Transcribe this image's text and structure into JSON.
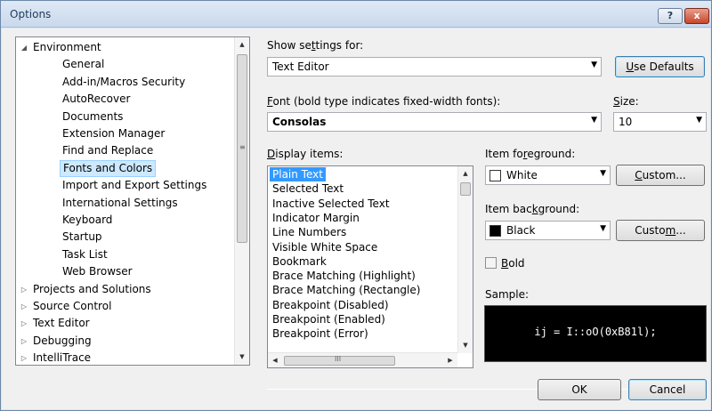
{
  "window": {
    "title": "Options",
    "help_label": "?",
    "close_label": "x"
  },
  "tree": {
    "items": [
      {
        "label": "Environment",
        "expander": "◢"
      },
      {
        "label": "General"
      },
      {
        "label": "Add-in/Macros Security"
      },
      {
        "label": "AutoRecover"
      },
      {
        "label": "Documents"
      },
      {
        "label": "Extension Manager"
      },
      {
        "label": "Find and Replace"
      },
      {
        "label": "Fonts and Colors",
        "selected": true
      },
      {
        "label": "Import and Export Settings"
      },
      {
        "label": "International Settings"
      },
      {
        "label": "Keyboard"
      },
      {
        "label": "Startup"
      },
      {
        "label": "Task List"
      },
      {
        "label": "Web Browser"
      },
      {
        "label": "Projects and Solutions",
        "expander": "▷"
      },
      {
        "label": "Source Control",
        "expander": "▷"
      },
      {
        "label": "Text Editor",
        "expander": "▷"
      },
      {
        "label": "Debugging",
        "expander": "▷"
      },
      {
        "label": "IntelliTrace",
        "expander": "▷"
      }
    ]
  },
  "show_settings": {
    "label_pre": "Show se",
    "label_key": "t",
    "label_post": "tings for:",
    "value": "Text Editor"
  },
  "use_defaults": {
    "label_key": "U",
    "label_post": "se Defaults"
  },
  "font": {
    "label_key": "F",
    "label_post": "ont (bold type indicates fixed-width fonts):",
    "value": "Consolas"
  },
  "size": {
    "label_key": "S",
    "label_post": "ize:",
    "value": "10"
  },
  "display_items": {
    "label_key": "D",
    "label_post": "isplay items:",
    "items": [
      "Plain Text",
      "Selected Text",
      "Inactive Selected Text",
      "Indicator Margin",
      "Line Numbers",
      "Visible White Space",
      "Bookmark",
      "Brace Matching (Highlight)",
      "Brace Matching (Rectangle)",
      "Breakpoint (Disabled)",
      "Breakpoint (Enabled)",
      "Breakpoint (Error)"
    ],
    "selected_index": 0
  },
  "item_foreground": {
    "label_pre": "Item fo",
    "label_key": "r",
    "label_post": "eground:",
    "value": "White",
    "swatch_color": "#ffffff"
  },
  "item_background": {
    "label_pre": "Item bac",
    "label_key": "k",
    "label_post": "ground:",
    "value": "Black",
    "swatch_color": "#000000"
  },
  "custom_fg": {
    "label_key": "C",
    "label_post": "ustom..."
  },
  "custom_bg": {
    "label_pre": "Custo",
    "label_key": "m",
    "label_post": "..."
  },
  "bold": {
    "label_key": "B",
    "label_post": "old",
    "checked": false
  },
  "sample": {
    "label": "Sample:",
    "text": "ij = I::oO(0xB81l);"
  },
  "buttons": {
    "ok": "OK",
    "cancel": "Cancel"
  },
  "colors": {
    "selection_blue": "#3399ff",
    "tree_selection": "#cde8ff",
    "sample_bg": "#000000",
    "sample_fg": "#ffffff"
  }
}
